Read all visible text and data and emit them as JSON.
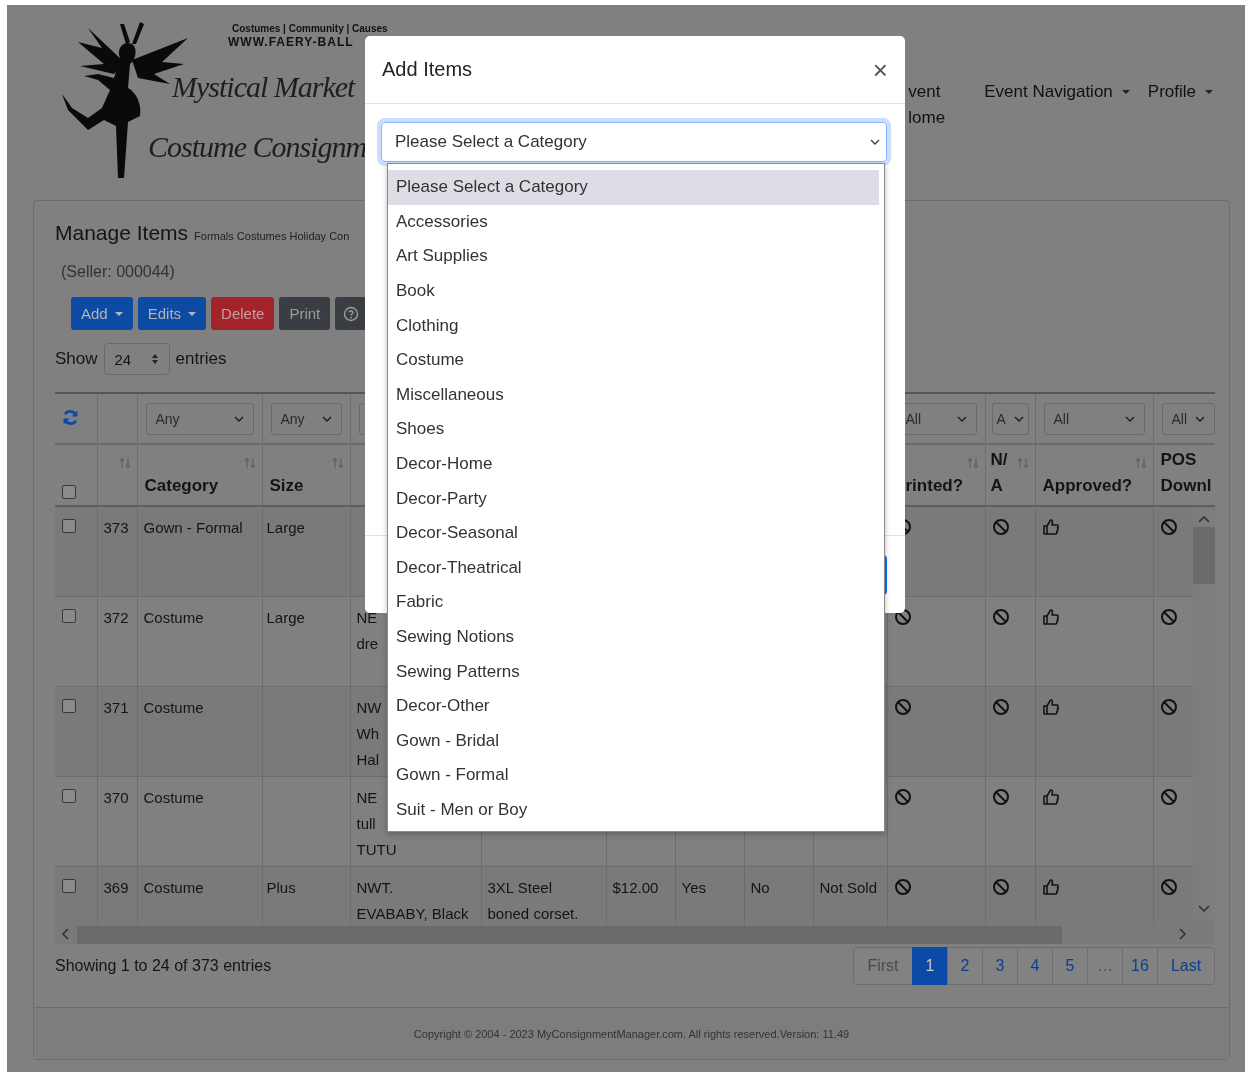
{
  "header": {
    "tagline": "Costumes | Community | Causes",
    "site": "WWW.FAERY-BALL",
    "logo_lines": [
      "Mystical Market",
      "Costume Consignm"
    ],
    "nav": [
      {
        "label": "vent lome",
        "dropdown": false
      },
      {
        "label": "Event Navigation",
        "dropdown": true
      },
      {
        "label": "Profile",
        "dropdown": true
      }
    ]
  },
  "card": {
    "title": "Manage Items",
    "subtitle": "Formals Costumes Holiday Con",
    "seller": "(Seller: 000044)",
    "buttons": [
      {
        "kind": "primary",
        "label": "Add",
        "dropdown": true
      },
      {
        "kind": "primary",
        "label": "Edits",
        "dropdown": true
      },
      {
        "kind": "danger",
        "label": "Delete",
        "dropdown": false
      },
      {
        "kind": "dark",
        "label": "Print",
        "dropdown": false
      },
      {
        "kind": "help"
      }
    ],
    "show": {
      "before": "Show",
      "value": "24",
      "after": "entries"
    }
  },
  "table": {
    "filters": [
      {
        "kind": "refresh"
      },
      {
        "kind": "blank"
      },
      {
        "kind": "select",
        "value": "Any"
      },
      {
        "kind": "select",
        "value": "Any"
      },
      {
        "kind": "select"
      },
      {
        "kind": "blank"
      },
      {
        "kind": "blank"
      },
      {
        "kind": "blank"
      },
      {
        "kind": "blank"
      },
      {
        "kind": "blank"
      },
      {
        "kind": "select",
        "value": "All"
      },
      {
        "kind": "select",
        "value": "A"
      },
      {
        "kind": "select",
        "value": "All"
      },
      {
        "kind": "select",
        "value": "All"
      }
    ],
    "select_all": {
      "checked": false
    },
    "columns": [
      {
        "sortable": true
      },
      {
        "label": "Category",
        "sortable": true
      },
      {
        "label": "Size",
        "sortable": true
      },
      {},
      {},
      {},
      {},
      {},
      {},
      {
        "label": "rinted?",
        "sortable": true
      },
      {
        "label": "N/A",
        "sortable": true
      },
      {
        "label": "Approved?",
        "sortable": true
      },
      {
        "label": "POS Downl"
      }
    ],
    "rows": [
      {
        "checked": false,
        "cells": [
          "373",
          "Gown - Formal",
          "Large",
          null,
          null,
          null,
          null,
          null,
          null,
          {
            "kind": "ban"
          },
          {
            "kind": "ban"
          },
          {
            "kind": "thumbs_up"
          },
          {
            "kind": "ban"
          }
        ]
      },
      {
        "checked": false,
        "cells": [
          "372",
          "Costume",
          "Large",
          "NE\ndre",
          null,
          null,
          null,
          null,
          null,
          {
            "kind": "ban"
          },
          {
            "kind": "ban"
          },
          {
            "kind": "thumbs_up"
          },
          {
            "kind": "ban"
          }
        ]
      },
      {
        "checked": false,
        "cells": [
          "371",
          "Costume",
          null,
          "NW\nWh\nHal",
          null,
          null,
          null,
          null,
          null,
          {
            "kind": "ban"
          },
          {
            "kind": "ban"
          },
          {
            "kind": "thumbs_up"
          },
          {
            "kind": "ban"
          }
        ]
      },
      {
        "checked": false,
        "cells": [
          "370",
          "Costume",
          null,
          "NE\ntull\nTUTU",
          null,
          null,
          null,
          null,
          null,
          {
            "kind": "ban"
          },
          {
            "kind": "ban"
          },
          {
            "kind": "thumbs_up"
          },
          {
            "kind": "ban"
          }
        ]
      },
      {
        "checked": false,
        "cells": [
          "369",
          "Costume",
          "Plus",
          "NWT.\nEVABABY, Black",
          "3XL Steel\nboned corset.",
          "$12.00",
          "Yes",
          "No",
          "Not Sold",
          {
            "kind": "ban"
          },
          {
            "kind": "ban"
          },
          {
            "kind": "thumbs_up"
          },
          {
            "kind": "ban"
          }
        ]
      }
    ],
    "info": "Showing 1 to 24 of 373 entries",
    "pagination": [
      {
        "label": "First",
        "selected": false,
        "disabled": true
      },
      {
        "label": "1",
        "selected": true,
        "disabled": false
      },
      {
        "label": "2",
        "selected": false,
        "disabled": false
      },
      {
        "label": "3",
        "selected": false,
        "disabled": false
      },
      {
        "label": "4",
        "selected": false,
        "disabled": false
      },
      {
        "label": "5",
        "selected": false,
        "disabled": false
      },
      {
        "label": "…",
        "selected": false,
        "disabled": true
      },
      {
        "label": "16",
        "selected": false,
        "disabled": false
      },
      {
        "label": "Last",
        "selected": false,
        "disabled": false
      }
    ]
  },
  "footer": "Copyright © 2004 - 2023 MyConsignmentManager.com. All rights reserved.Version: 11.49",
  "modal": {
    "title": "Add Items",
    "close": "×",
    "select": {
      "value": "Please Select a Category"
    },
    "options": [
      {
        "label": "Please Select a Category",
        "selected": true
      },
      {
        "label": "Accessories",
        "selected": false
      },
      {
        "label": "Art Supplies",
        "selected": false
      },
      {
        "label": "Book",
        "selected": false
      },
      {
        "label": "Clothing",
        "selected": false
      },
      {
        "label": "Costume",
        "selected": false
      },
      {
        "label": "Miscellaneous",
        "selected": false
      },
      {
        "label": "Shoes",
        "selected": false
      },
      {
        "label": "Decor-Home",
        "selected": false
      },
      {
        "label": "Decor-Party",
        "selected": false
      },
      {
        "label": "Decor-Seasonal",
        "selected": false
      },
      {
        "label": "Decor-Theatrical",
        "selected": false
      },
      {
        "label": "Fabric",
        "selected": false
      },
      {
        "label": "Sewing Notions",
        "selected": false
      },
      {
        "label": "Sewing Patterns",
        "selected": false
      },
      {
        "label": "Decor-Other",
        "selected": false
      },
      {
        "label": "Gown - Bridal",
        "selected": false
      },
      {
        "label": "Gown - Formal",
        "selected": false
      },
      {
        "label": "Suit - Men or Boy",
        "selected": false
      }
    ]
  }
}
